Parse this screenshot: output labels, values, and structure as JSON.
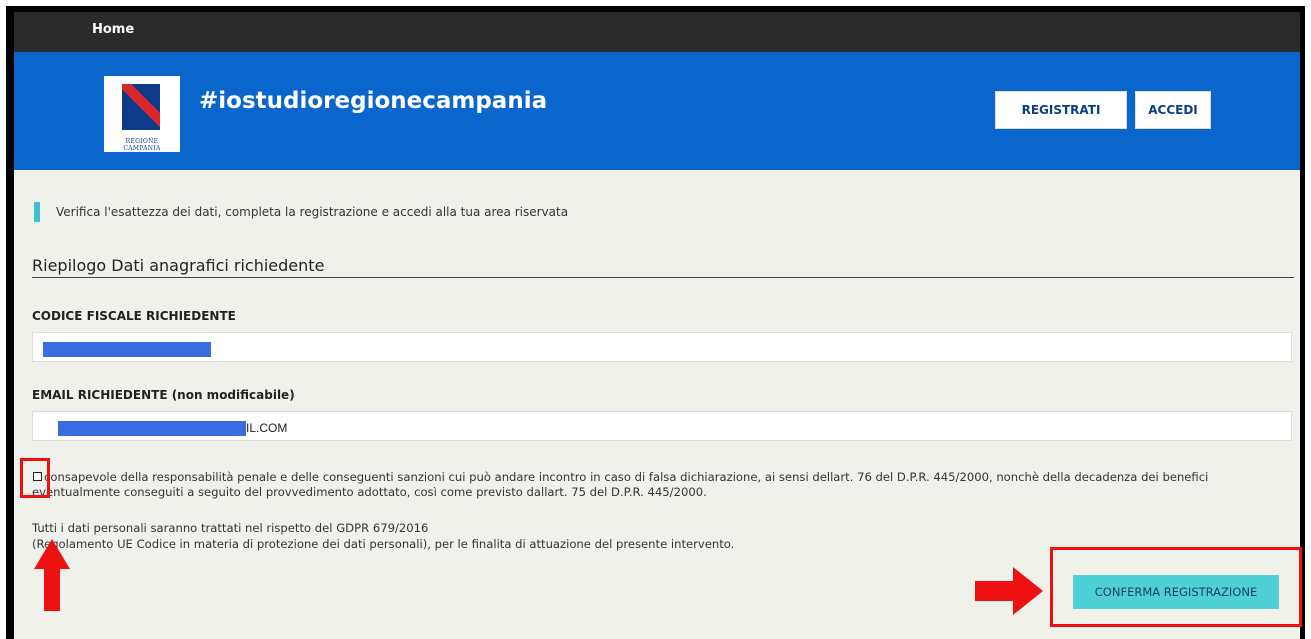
{
  "nav": {
    "home_label": "Home"
  },
  "header": {
    "site_title": "#iostudioregionecampania",
    "logo_caption": "REGIONE CAMPANIA",
    "register_label": "REGISTRATI",
    "login_label": "ACCEDI"
  },
  "main": {
    "notice": "Verifica l'esattezza dei dati, completa la registrazione e accedi alla tua area riservata",
    "section_title": "Riepilogo Dati anagrafici richiedente",
    "codice_fiscale": {
      "label": "CODICE FISCALE RICHIEDENTE",
      "value_visible": ""
    },
    "email": {
      "label": "EMAIL RICHIEDENTE (non modificabile)",
      "value_visible": "IL.COM"
    },
    "declaration": "consapevole della responsabilità penale e delle conseguenti sanzioni cui può andare incontro in caso di falsa dichiarazione, ai sensi dellart. 76 del D.P.R. 445/2000, nonchè della decadenza dei benefici eventualmente conseguiti a seguito del provvedimento adottato, così come previsto dallart. 75 del D.P.R. 445/2000.",
    "gdpr_line1": "Tutti i dati personali saranno trattati nel rispetto del GDPR 679/2016",
    "gdpr_line2": "(Regolamento UE Codice in materia di protezione dei dati personali), per le finalita di attuazione del presente intervento.",
    "confirm_label": "CONFERMA REGISTRAZIONE"
  },
  "colors": {
    "header_blue": "#0a66cc",
    "topbar": "#2b2b2b",
    "accent_teal": "#4fd0d6",
    "annotation_red": "#ee1111"
  }
}
